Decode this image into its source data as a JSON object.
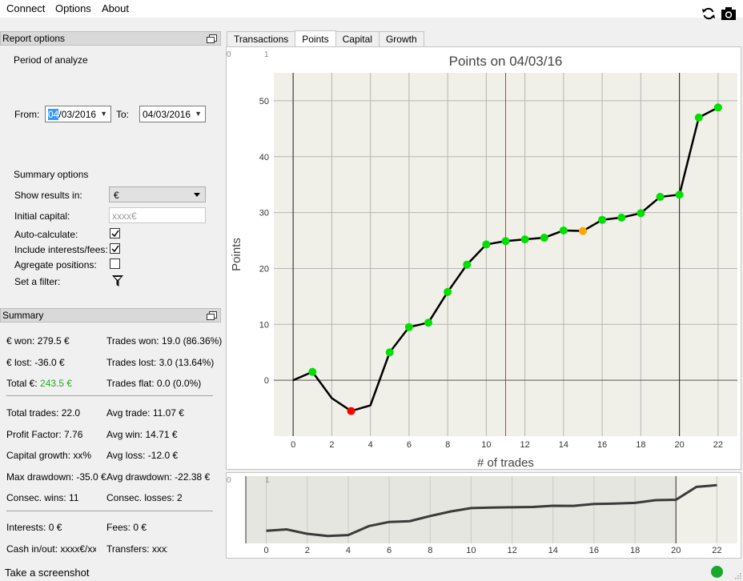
{
  "menu": {
    "connect": "Connect",
    "options": "Options",
    "about": "About"
  },
  "toolbar": {
    "refresh_icon": "refresh-icon",
    "camera_icon": "camera-icon"
  },
  "report_options": {
    "header": "Report options",
    "period_label": "Period of analyze",
    "from_label": "From:",
    "from_selected": "04",
    "from_rest": "/03/2016",
    "to_label": "To:",
    "to_value": "04/03/2016",
    "summary_options_label": "Summary options",
    "show_results_label": "Show results in:",
    "show_results_value": "€",
    "initial_capital_label": "Initial capital:",
    "initial_capital_placeholder": "xxxx€",
    "auto_calc_label": "Auto-calculate:",
    "auto_calc_checked": true,
    "include_fees_label": "Include interests/fees:",
    "include_fees_checked": true,
    "aggregate_label": "Agregate positions:",
    "aggregate_checked": false,
    "filter_label": "Set a filter:",
    "filter_icon": "filter-funnel-icon"
  },
  "summary": {
    "header": "Summary",
    "won": "€ won: 279.5 €",
    "trades_won": "Trades won: 19.0 (86.36%)",
    "lost": "€ lost: -36.0 €",
    "trades_lost": "Trades lost: 3.0 (13.64%)",
    "total_label": "Total €:",
    "total_value": "243.5 €",
    "total_color": "#22aa22",
    "trades_flat": "Trades flat: 0.0 (0.0%)",
    "total_trades": "Total trades: 22.0",
    "avg_trade": "Avg trade: 11.07 €",
    "profit_factor": "Profit Factor: 7.76",
    "avg_win": "Avg win: 14.71 €",
    "capital_growth": "Capital growth: xx%",
    "avg_loss": "Avg loss: -12.0 €",
    "max_drawdown": "Max drawdown: -35.0 €",
    "avg_drawdown": "Avg drawdown: -22.38 €",
    "consec_wins": "Consec. wins: 11",
    "consec_losses": "Consec. losses: 2",
    "interests": "Interests: 0 €",
    "fees": "Fees: 0 €",
    "cash_inout": "Cash in/out: xxxx€/xxx",
    "transfers": "Transfers: xxxx"
  },
  "tabs": [
    {
      "label": "Transactions",
      "active": false
    },
    {
      "label": "Points",
      "active": true
    },
    {
      "label": "Capital",
      "active": false
    },
    {
      "label": "Growth",
      "active": false
    }
  ],
  "chart_data": {
    "type": "line",
    "title": "Points on 04/03/16",
    "xlabel": "# of trades",
    "ylabel": "Points",
    "corner_labels": [
      "0",
      "1"
    ],
    "x": [
      0,
      1,
      2,
      3,
      4,
      5,
      6,
      7,
      8,
      9,
      10,
      11,
      12,
      13,
      14,
      15,
      16,
      17,
      18,
      19,
      20,
      21,
      22
    ],
    "y": [
      0,
      1.5,
      -3.2,
      -5.5,
      -4.5,
      5,
      9.5,
      10.3,
      15.8,
      20.7,
      24.3,
      24.9,
      25.2,
      25.5,
      26.8,
      26.7,
      28.7,
      29.1,
      29.9,
      32.8,
      33.2,
      47,
      48.8
    ],
    "marker_colors": [
      "none",
      "#00e000",
      "none",
      "#ff0000",
      "none",
      "#00e000",
      "#00e000",
      "#00e000",
      "#00e000",
      "#00e000",
      "#00e000",
      "#00e000",
      "#00e000",
      "#00e000",
      "#00e000",
      "#ffa500",
      "#00e000",
      "#00e000",
      "#00e000",
      "#00e000",
      "#00e000",
      "#00e000",
      "#00e000"
    ],
    "xlim": [
      -1,
      23
    ],
    "ylim": [
      -10,
      55
    ],
    "xticks": [
      0,
      2,
      4,
      6,
      8,
      10,
      12,
      14,
      16,
      18,
      20,
      22
    ],
    "yticks": [
      0,
      10,
      20,
      30,
      40,
      50
    ],
    "red_vline_x": 11,
    "black_vline_x": [
      0,
      20
    ],
    "grid": true
  },
  "overview": {
    "corner_labels": [
      "0",
      "1"
    ],
    "xticks": [
      0,
      2,
      4,
      6,
      8,
      10,
      12,
      14,
      16,
      18,
      20,
      22
    ],
    "region_x": [
      -1,
      20
    ]
  },
  "status": {
    "text": "Take a screenshot",
    "dot_color": "#19a82b"
  }
}
